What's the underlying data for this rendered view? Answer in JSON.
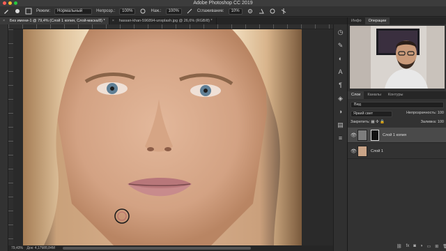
{
  "app": {
    "title": "Adobe Photoshop CC 2019"
  },
  "options": {
    "mode_label": "Режим:",
    "mode_value": "Нормальный",
    "opacity_label": "Непрозр.:",
    "opacity_value": "100%",
    "flow_label": "Наж.:",
    "flow_value": "100%",
    "smoothing_label": "Сглаживание:",
    "smoothing_value": "10%"
  },
  "tabs": [
    {
      "label": "Без имени-1 @ 79,4% (Слой 1 копия, Слой-маска/8) *"
    },
    {
      "label": "hassan-khan-596894-unsplash.jpg @ 26,6% (RGB/8) *"
    }
  ],
  "status": {
    "zoom": "79,43%",
    "doc": "Док: 4,17M/8,84M"
  },
  "panel": {
    "top_tabs": [
      "Инфо",
      "Операции"
    ],
    "layer_tabs": [
      "Слои",
      "Каналы",
      "Контуры"
    ],
    "search_value": "Вид",
    "blend_mode": "Яркий свет",
    "opacity_label": "Непрозрачность:",
    "opacity_value": "100",
    "lock_label": "Закрепить:",
    "fill_label": "Заливка:",
    "fill_value": "100",
    "layers": [
      {
        "name": "Слой 1 копия",
        "selected": true
      },
      {
        "name": "Слой 1",
        "selected": false
      }
    ]
  },
  "colors": {
    "accent": "#4a4a4a",
    "close": "#ff5f57",
    "minimize": "#febc2e",
    "zoom": "#28c840"
  }
}
